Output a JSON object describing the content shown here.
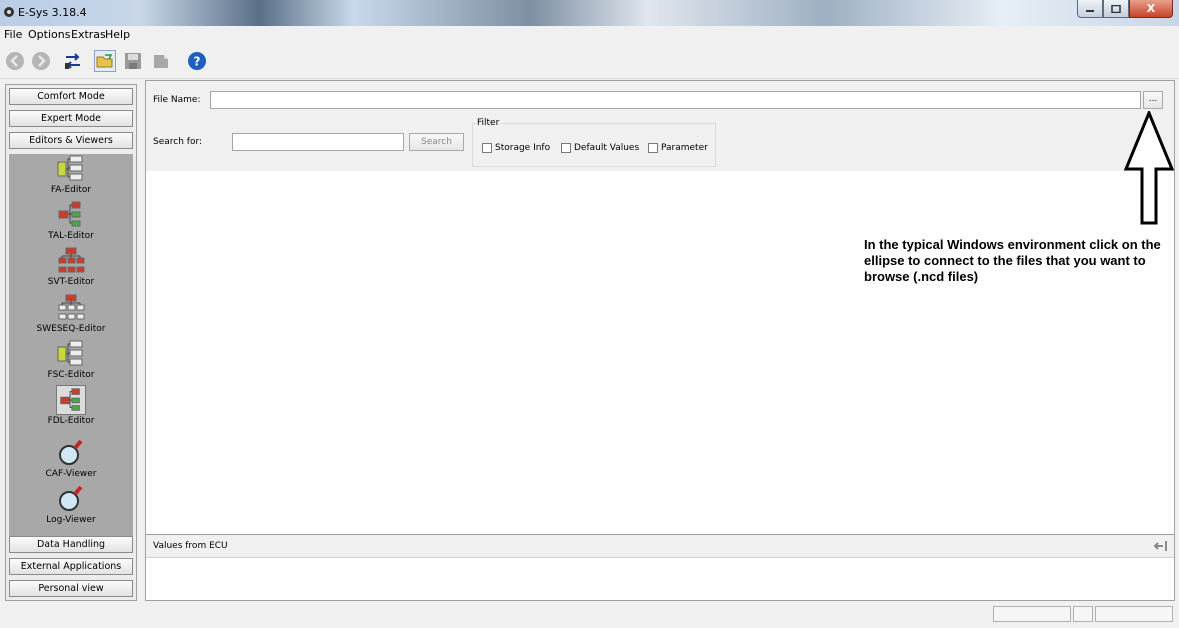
{
  "window": {
    "title": "E-Sys 3.18.4",
    "close_glyph": "X"
  },
  "menu": {
    "items": [
      "File",
      "Options",
      "Extras",
      "Help"
    ]
  },
  "sidebar": {
    "top_buttons": [
      "Comfort Mode",
      "Expert Mode",
      "Editors & Viewers"
    ],
    "editors": [
      "FA-Editor",
      "TAL-Editor",
      "SVT-Editor",
      "SWESEQ-Editor",
      "FSC-Editor",
      "FDL-Editor",
      "CAF-Viewer",
      "Log-Viewer"
    ],
    "bottom_buttons": [
      "Data Handling",
      "External Applications",
      "Personal view"
    ]
  },
  "file_panel": {
    "file_name_label": "File Name:",
    "file_name_value": "",
    "browse_label": "...",
    "search_label": "Search for:",
    "search_value": "",
    "search_button": "Search",
    "filter_label": "Filter",
    "filters": [
      {
        "label": "Storage Info",
        "checked": false
      },
      {
        "label": "Default Values",
        "checked": false
      },
      {
        "label": "Parameter",
        "checked": false
      }
    ]
  },
  "annotation": {
    "text": "In the typical Windows environment click on the ellipse to connect to the files that you want to browse (.ncd files)"
  },
  "values_panel": {
    "title": "Values from ECU"
  },
  "colors": {
    "titlebar": "#c8d6e8",
    "sidebar_panel": "#a8a8a8",
    "close_button": "#c7432a"
  }
}
